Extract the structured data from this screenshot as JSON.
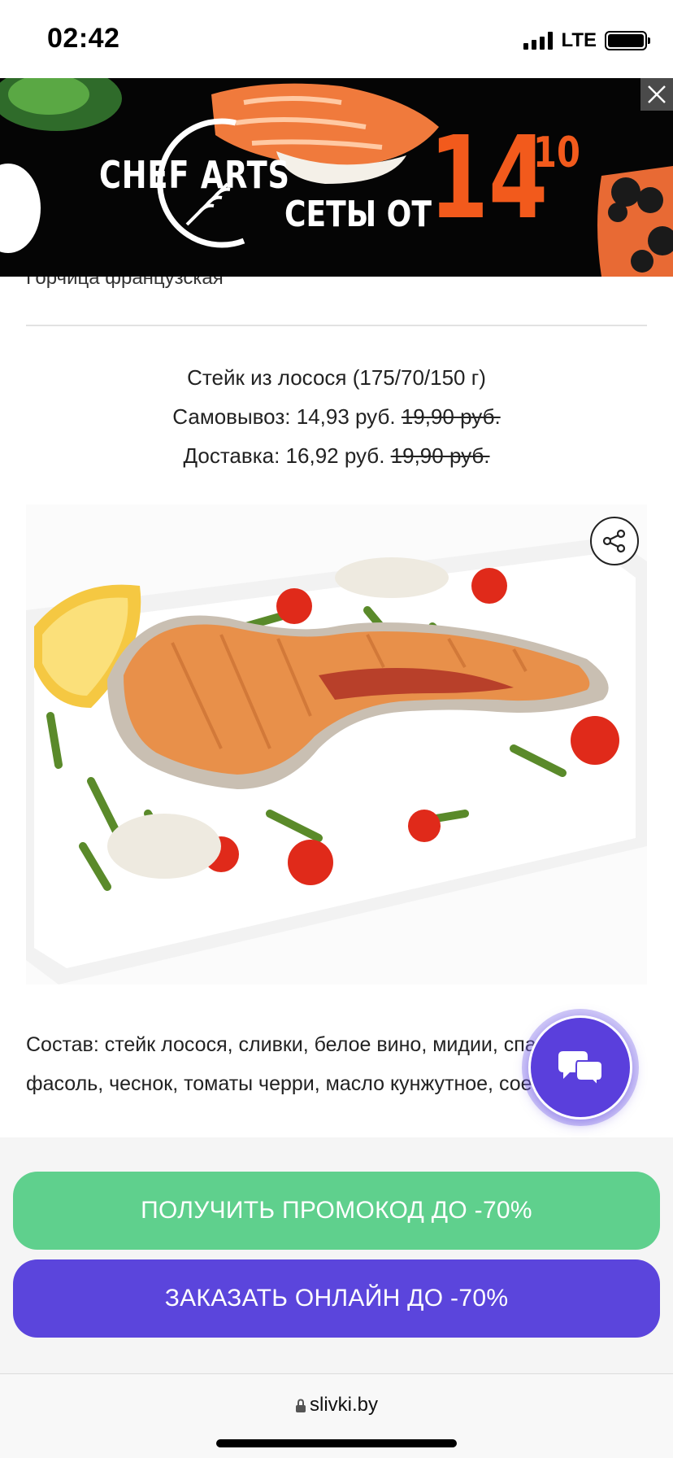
{
  "status_bar": {
    "time": "02:42",
    "network": "LTE"
  },
  "ad": {
    "brand": "CHEF ARTS",
    "sets_text": "СЕТЫ ОТ",
    "price_main": "14",
    "price_cents": "10",
    "colors": {
      "price": "#f25a1c",
      "background": "#050505"
    }
  },
  "previous_item": "Горчица французская",
  "dish": {
    "name": "Стейк из лосося (175/70/150 г)",
    "pickup_label": "Самовывоз: 14,93 руб.",
    "pickup_old_price": "19,90 руб.",
    "delivery_label": "Доставка: 16,92 руб.",
    "delivery_old_price": "19,90 руб.",
    "composition": "Состав: стейк лосося, сливки, белое вино, мидии, спаржевая фасоль, чеснок, томаты черри, масло кунжутное, соевый соус"
  },
  "buttons": {
    "promo": "ПОЛУЧИТЬ ПРОМОКОД ДО -70%",
    "order": "ЗАКАЗАТЬ ОНЛАЙН ДО -70%",
    "colors": {
      "promo": "#5fd08d",
      "order": "#5b45dc"
    }
  },
  "browser": {
    "url": "slivki.by"
  },
  "icons": {
    "share": "share-icon",
    "chat": "chat-icon",
    "close_ad": "close-icon",
    "lock": "lock-icon"
  }
}
